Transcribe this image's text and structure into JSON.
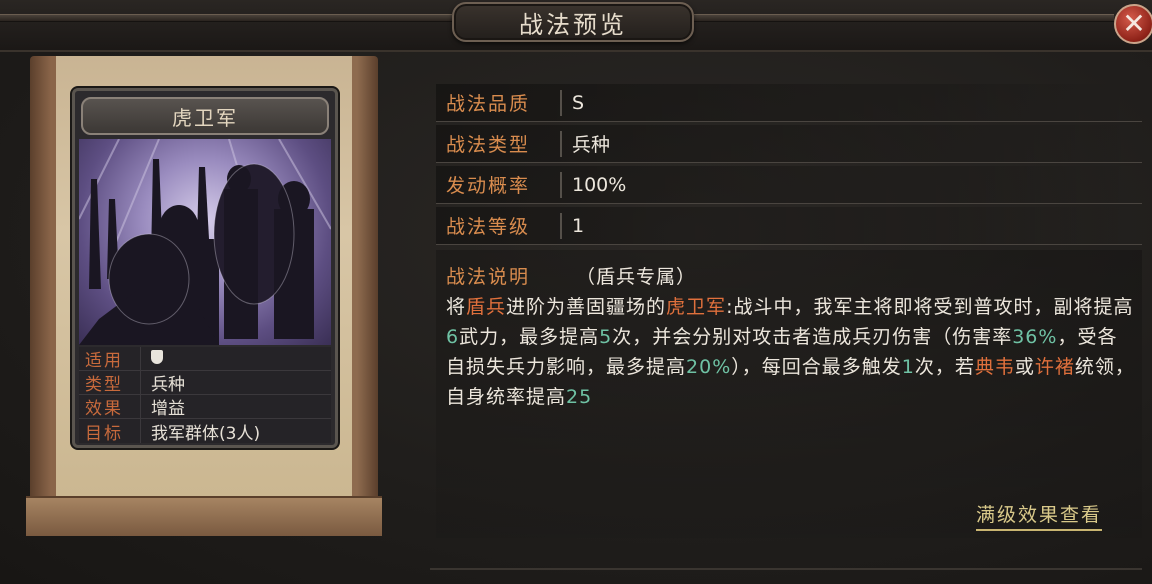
{
  "window": {
    "title": "战法预览",
    "close_label": "✕"
  },
  "card": {
    "name": "虎卫军",
    "stats": [
      {
        "key": "适用",
        "value": "",
        "icon": "shield-icon"
      },
      {
        "key": "类型",
        "value": "兵种"
      },
      {
        "key": "效果",
        "value": "增益"
      },
      {
        "key": "目标",
        "value": "我军群体(3人)"
      }
    ]
  },
  "info": {
    "rows": [
      {
        "key": "战法品质",
        "value": "S"
      },
      {
        "key": "战法类型",
        "value": "兵种"
      },
      {
        "key": "发动概率",
        "value": "100%"
      },
      {
        "key": "战法等级",
        "value": "1"
      }
    ],
    "desc_key": "战法说明",
    "desc_sub": "（盾兵专属）",
    "desc_parts": {
      "p1": "将",
      "p2": "盾兵",
      "p3": "进阶为善固疆场的",
      "p4": "虎卫军",
      "p5": ":战斗中，我军主将即将受到普攻时，副将提高",
      "p6": "6",
      "p7": "武力，最多提高",
      "p8": "5",
      "p9": "次，并会分别对攻击者造成兵刃伤害（伤害率",
      "p10": "36%",
      "p11": "，受各自损失兵力影响，最多提高",
      "p12": "20%",
      "p13": "），每回合最多触发",
      "p14": "1",
      "p15": "次，若",
      "p16": "典韦",
      "p17": "或",
      "p18": "许褚",
      "p19": "统领，自身统率提高",
      "p20": "25"
    },
    "full_effect_link": "满级效果查看"
  },
  "colors": {
    "accent": "#d98c4e",
    "highlight_red": "#e0703c",
    "highlight_green": "#6fc2a4",
    "close": "#8e2218"
  }
}
